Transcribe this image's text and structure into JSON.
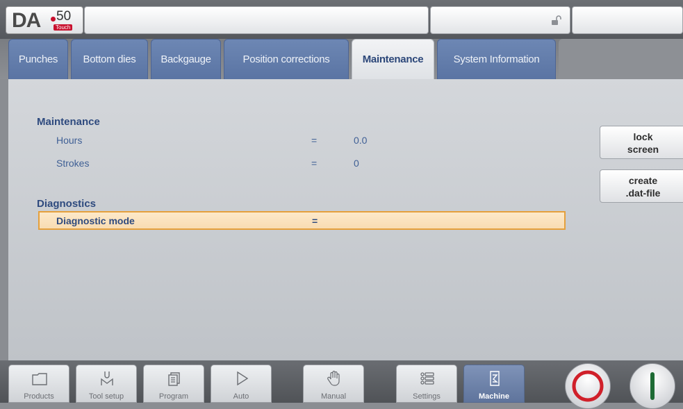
{
  "logo": {
    "brand": "DA",
    "model": "50",
    "touch": "Touch"
  },
  "topbar": {
    "lock_state": "unlocked"
  },
  "tabs": [
    {
      "label": "Punches",
      "active": false
    },
    {
      "label": "Bottom dies",
      "active": false
    },
    {
      "label": "Backgauge",
      "active": false
    },
    {
      "label": "Position corrections",
      "active": false
    },
    {
      "label": "Maintenance",
      "active": true
    },
    {
      "label": "System Information",
      "active": false
    }
  ],
  "maintenance": {
    "title": "Maintenance",
    "rows": [
      {
        "label": "Hours",
        "eq": "=",
        "value": "0.0"
      },
      {
        "label": "Strokes",
        "eq": "=",
        "value": "0"
      }
    ]
  },
  "diagnostics": {
    "title": "Diagnostics",
    "row": {
      "label": "Diagnostic mode",
      "eq": "=",
      "value": ""
    }
  },
  "side_buttons": {
    "lock_screen": "lock\nscreen",
    "create_dat": "create\n.dat-file"
  },
  "nav": [
    {
      "label": "Products",
      "icon": "folder-icon"
    },
    {
      "label": "Tool setup",
      "icon": "tool-setup-icon"
    },
    {
      "label": "Program",
      "icon": "program-icon"
    },
    {
      "label": "Auto",
      "icon": "play-icon"
    },
    {
      "label": "Manual",
      "icon": "hand-icon"
    },
    {
      "label": "Settings",
      "icon": "settings-list-icon"
    },
    {
      "label": "Machine",
      "icon": "machine-icon",
      "active": true
    }
  ],
  "colors": {
    "stop": "#d0202a",
    "start": "#1e6b35",
    "accent": "#2e4a7e",
    "highlight_border": "#e5a03c"
  }
}
